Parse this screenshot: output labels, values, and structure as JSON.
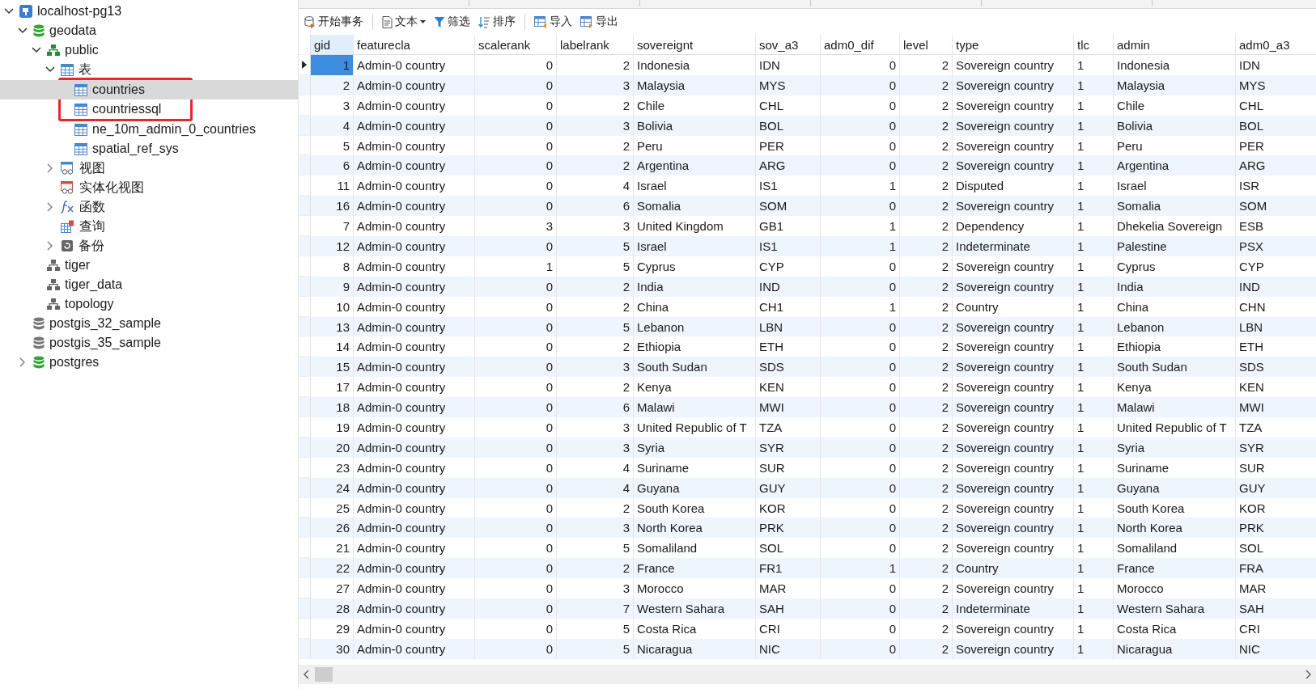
{
  "tree": [
    {
      "label": "localhost-pg13",
      "kind": "server",
      "expandable": true,
      "expanded": true,
      "selected": false,
      "annotated": false,
      "children": [
        {
          "label": "geodata",
          "kind": "database",
          "connected": true,
          "expandable": true,
          "expanded": true,
          "selected": false,
          "annotated": false,
          "children": [
            {
              "label": "public",
              "kind": "schema",
              "expandable": true,
              "expanded": true,
              "selected": false,
              "annotated": false,
              "children": [
                {
                  "label": "表",
                  "kind": "tables",
                  "expandable": true,
                  "expanded": true,
                  "selected": false,
                  "annotated": false,
                  "children": [
                    {
                      "label": "countries",
                      "kind": "table",
                      "expandable": false,
                      "selected": true,
                      "annotated": true
                    },
                    {
                      "label": "countriessql",
                      "kind": "table",
                      "expandable": false,
                      "selected": false,
                      "annotated": true
                    },
                    {
                      "label": "ne_10m_admin_0_countries",
                      "kind": "table",
                      "expandable": false,
                      "selected": false,
                      "annotated": false
                    },
                    {
                      "label": "spatial_ref_sys",
                      "kind": "table",
                      "expandable": false,
                      "selected": false,
                      "annotated": false
                    }
                  ]
                },
                {
                  "label": "视图",
                  "kind": "view",
                  "expandable": true,
                  "expanded": false,
                  "selected": false,
                  "annotated": false
                },
                {
                  "label": "实体化视图",
                  "kind": "matview",
                  "expandable": false,
                  "selected": false,
                  "annotated": false
                },
                {
                  "label": "函数",
                  "kind": "function",
                  "expandable": true,
                  "expanded": false,
                  "selected": false,
                  "annotated": false
                },
                {
                  "label": "查询",
                  "kind": "query",
                  "expandable": false,
                  "selected": false,
                  "annotated": false
                },
                {
                  "label": "备份",
                  "kind": "backup",
                  "expandable": true,
                  "expanded": false,
                  "selected": false,
                  "annotated": false
                }
              ]
            },
            {
              "label": "tiger",
              "kind": "schema-plain",
              "expandable": false,
              "selected": false,
              "annotated": false
            },
            {
              "label": "tiger_data",
              "kind": "schema-plain",
              "expandable": false,
              "selected": false,
              "annotated": false
            },
            {
              "label": "topology",
              "kind": "schema-plain",
              "expandable": false,
              "selected": false,
              "annotated": false
            }
          ]
        },
        {
          "label": "postgis_32_sample",
          "kind": "database",
          "connected": false,
          "expandable": false,
          "selected": false,
          "annotated": false
        },
        {
          "label": "postgis_35_sample",
          "kind": "database",
          "connected": false,
          "expandable": false,
          "selected": false,
          "annotated": false
        },
        {
          "label": "postgres",
          "kind": "database",
          "connected": true,
          "expandable": true,
          "expanded": false,
          "selected": false,
          "annotated": false
        }
      ]
    }
  ],
  "toolbar": [
    {
      "label": "开始事务",
      "kind": "transaction",
      "dropdown": false
    },
    {
      "label": "文本",
      "kind": "text",
      "dropdown": true
    },
    {
      "label": "筛选",
      "kind": "filter",
      "dropdown": false
    },
    {
      "label": "排序",
      "kind": "sort",
      "dropdown": false
    },
    {
      "label": "导入",
      "kind": "import",
      "dropdown": false
    },
    {
      "label": "导出",
      "kind": "export",
      "dropdown": false
    }
  ],
  "table": {
    "columns": [
      {
        "label": "gid",
        "numeric": true,
        "selected": true
      },
      {
        "label": "featurecla",
        "numeric": false,
        "selected": false
      },
      {
        "label": "scalerank",
        "numeric": true,
        "selected": false
      },
      {
        "label": "labelrank",
        "numeric": true,
        "selected": false
      },
      {
        "label": "sovereignt",
        "numeric": false,
        "selected": false
      },
      {
        "label": "sov_a3",
        "numeric": false,
        "selected": false
      },
      {
        "label": "adm0_dif",
        "numeric": true,
        "selected": false
      },
      {
        "label": "level",
        "numeric": true,
        "selected": false
      },
      {
        "label": "type",
        "numeric": false,
        "selected": false
      },
      {
        "label": "tlc",
        "numeric": false,
        "selected": false
      },
      {
        "label": "admin",
        "numeric": false,
        "selected": false
      },
      {
        "label": "adm0_a3",
        "numeric": false,
        "selected": false
      }
    ],
    "rows": [
      {
        "selected": true,
        "cells": [
          "1",
          "Admin-0 country",
          "0",
          "2",
          "Indonesia",
          "IDN",
          "0",
          "2",
          "Sovereign country",
          "1",
          "Indonesia",
          "IDN"
        ]
      },
      {
        "selected": false,
        "cells": [
          "2",
          "Admin-0 country",
          "0",
          "3",
          "Malaysia",
          "MYS",
          "0",
          "2",
          "Sovereign country",
          "1",
          "Malaysia",
          "MYS"
        ]
      },
      {
        "selected": false,
        "cells": [
          "3",
          "Admin-0 country",
          "0",
          "2",
          "Chile",
          "CHL",
          "0",
          "2",
          "Sovereign country",
          "1",
          "Chile",
          "CHL"
        ]
      },
      {
        "selected": false,
        "cells": [
          "4",
          "Admin-0 country",
          "0",
          "3",
          "Bolivia",
          "BOL",
          "0",
          "2",
          "Sovereign country",
          "1",
          "Bolivia",
          "BOL"
        ]
      },
      {
        "selected": false,
        "cells": [
          "5",
          "Admin-0 country",
          "0",
          "2",
          "Peru",
          "PER",
          "0",
          "2",
          "Sovereign country",
          "1",
          "Peru",
          "PER"
        ]
      },
      {
        "selected": false,
        "cells": [
          "6",
          "Admin-0 country",
          "0",
          "2",
          "Argentina",
          "ARG",
          "0",
          "2",
          "Sovereign country",
          "1",
          "Argentina",
          "ARG"
        ]
      },
      {
        "selected": false,
        "cells": [
          "11",
          "Admin-0 country",
          "0",
          "4",
          "Israel",
          "IS1",
          "1",
          "2",
          "Disputed",
          "1",
          "Israel",
          "ISR"
        ]
      },
      {
        "selected": false,
        "cells": [
          "16",
          "Admin-0 country",
          "0",
          "6",
          "Somalia",
          "SOM",
          "0",
          "2",
          "Sovereign country",
          "1",
          "Somalia",
          "SOM"
        ]
      },
      {
        "selected": false,
        "cells": [
          "7",
          "Admin-0 country",
          "3",
          "3",
          "United Kingdom",
          "GB1",
          "1",
          "2",
          "Dependency",
          "1",
          "Dhekelia Sovereign",
          "ESB"
        ]
      },
      {
        "selected": false,
        "cells": [
          "12",
          "Admin-0 country",
          "0",
          "5",
          "Israel",
          "IS1",
          "1",
          "2",
          "Indeterminate",
          "1",
          "Palestine",
          "PSX"
        ]
      },
      {
        "selected": false,
        "cells": [
          "8",
          "Admin-0 country",
          "1",
          "5",
          "Cyprus",
          "CYP",
          "0",
          "2",
          "Sovereign country",
          "1",
          "Cyprus",
          "CYP"
        ]
      },
      {
        "selected": false,
        "cells": [
          "9",
          "Admin-0 country",
          "0",
          "2",
          "India",
          "IND",
          "0",
          "2",
          "Sovereign country",
          "1",
          "India",
          "IND"
        ]
      },
      {
        "selected": false,
        "cells": [
          "10",
          "Admin-0 country",
          "0",
          "2",
          "China",
          "CH1",
          "1",
          "2",
          "Country",
          "1",
          "China",
          "CHN"
        ]
      },
      {
        "selected": false,
        "cells": [
          "13",
          "Admin-0 country",
          "0",
          "5",
          "Lebanon",
          "LBN",
          "0",
          "2",
          "Sovereign country",
          "1",
          "Lebanon",
          "LBN"
        ]
      },
      {
        "selected": false,
        "cells": [
          "14",
          "Admin-0 country",
          "0",
          "2",
          "Ethiopia",
          "ETH",
          "0",
          "2",
          "Sovereign country",
          "1",
          "Ethiopia",
          "ETH"
        ]
      },
      {
        "selected": false,
        "cells": [
          "15",
          "Admin-0 country",
          "0",
          "3",
          "South Sudan",
          "SDS",
          "0",
          "2",
          "Sovereign country",
          "1",
          "South Sudan",
          "SDS"
        ]
      },
      {
        "selected": false,
        "cells": [
          "17",
          "Admin-0 country",
          "0",
          "2",
          "Kenya",
          "KEN",
          "0",
          "2",
          "Sovereign country",
          "1",
          "Kenya",
          "KEN"
        ]
      },
      {
        "selected": false,
        "cells": [
          "18",
          "Admin-0 country",
          "0",
          "6",
          "Malawi",
          "MWI",
          "0",
          "2",
          "Sovereign country",
          "1",
          "Malawi",
          "MWI"
        ]
      },
      {
        "selected": false,
        "cells": [
          "19",
          "Admin-0 country",
          "0",
          "3",
          "United Republic of T",
          "TZA",
          "0",
          "2",
          "Sovereign country",
          "1",
          "United Republic of T",
          "TZA"
        ]
      },
      {
        "selected": false,
        "cells": [
          "20",
          "Admin-0 country",
          "0",
          "3",
          "Syria",
          "SYR",
          "0",
          "2",
          "Sovereign country",
          "1",
          "Syria",
          "SYR"
        ]
      },
      {
        "selected": false,
        "cells": [
          "23",
          "Admin-0 country",
          "0",
          "4",
          "Suriname",
          "SUR",
          "0",
          "2",
          "Sovereign country",
          "1",
          "Suriname",
          "SUR"
        ]
      },
      {
        "selected": false,
        "cells": [
          "24",
          "Admin-0 country",
          "0",
          "4",
          "Guyana",
          "GUY",
          "0",
          "2",
          "Sovereign country",
          "1",
          "Guyana",
          "GUY"
        ]
      },
      {
        "selected": false,
        "cells": [
          "25",
          "Admin-0 country",
          "0",
          "2",
          "South Korea",
          "KOR",
          "0",
          "2",
          "Sovereign country",
          "1",
          "South Korea",
          "KOR"
        ]
      },
      {
        "selected": false,
        "cells": [
          "26",
          "Admin-0 country",
          "0",
          "3",
          "North Korea",
          "PRK",
          "0",
          "2",
          "Sovereign country",
          "1",
          "North Korea",
          "PRK"
        ]
      },
      {
        "selected": false,
        "cells": [
          "21",
          "Admin-0 country",
          "0",
          "5",
          "Somaliland",
          "SOL",
          "0",
          "2",
          "Sovereign country",
          "1",
          "Somaliland",
          "SOL"
        ]
      },
      {
        "selected": false,
        "cells": [
          "22",
          "Admin-0 country",
          "0",
          "2",
          "France",
          "FR1",
          "1",
          "2",
          "Country",
          "1",
          "France",
          "FRA"
        ]
      },
      {
        "selected": false,
        "cells": [
          "27",
          "Admin-0 country",
          "0",
          "3",
          "Morocco",
          "MAR",
          "0",
          "2",
          "Sovereign country",
          "1",
          "Morocco",
          "MAR"
        ]
      },
      {
        "selected": false,
        "cells": [
          "28",
          "Admin-0 country",
          "0",
          "7",
          "Western Sahara",
          "SAH",
          "0",
          "2",
          "Indeterminate",
          "1",
          "Western Sahara",
          "SAH"
        ]
      },
      {
        "selected": false,
        "cells": [
          "29",
          "Admin-0 country",
          "0",
          "5",
          "Costa Rica",
          "CRI",
          "0",
          "2",
          "Sovereign country",
          "1",
          "Costa Rica",
          "CRI"
        ]
      },
      {
        "selected": false,
        "cells": [
          "30",
          "Admin-0 country",
          "0",
          "5",
          "Nicaragua",
          "NIC",
          "0",
          "2",
          "Sovereign country",
          "1",
          "Nicaragua",
          "NIC"
        ]
      }
    ]
  }
}
